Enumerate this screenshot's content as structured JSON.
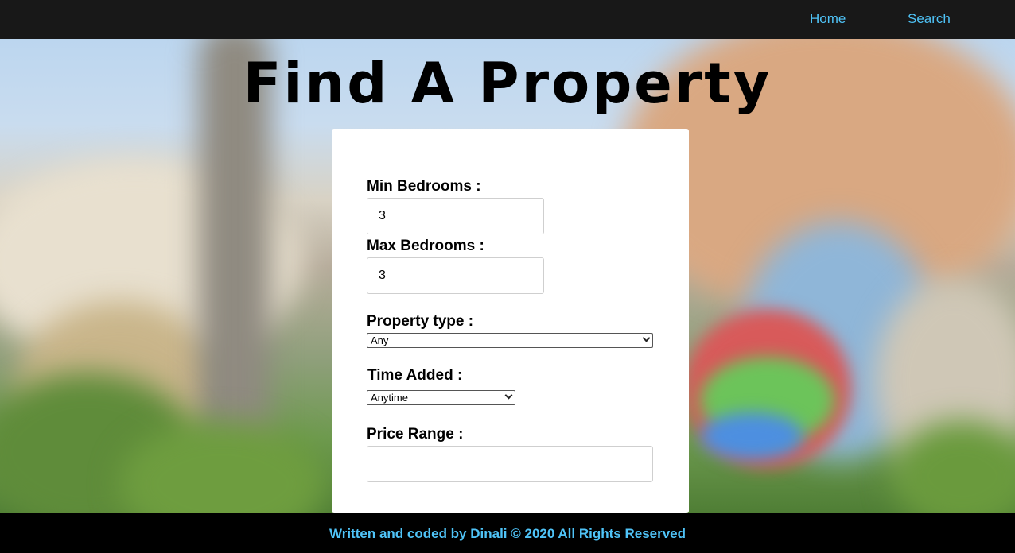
{
  "nav": {
    "home_label": "Home",
    "search_label": "Search"
  },
  "page": {
    "title": "Find A Property"
  },
  "form": {
    "min_bedrooms_label": "Min Bedrooms :",
    "min_bedrooms_value": "3",
    "max_bedrooms_label": "Max Bedrooms :",
    "max_bedrooms_value": "3",
    "property_type_label": "Property type :",
    "property_type_selected": "Any",
    "time_added_label": "Time Added :",
    "time_added_selected": "Anytime",
    "price_range_label": "Price Range :",
    "price_range_value": ""
  },
  "footer": {
    "text": "Written and coded by Dinali © 2020 All Rights Reserved"
  },
  "colors": {
    "nav_background": "#181818",
    "link": "#4fc3f7",
    "footer_background": "#000000",
    "card_background": "#ffffff"
  }
}
